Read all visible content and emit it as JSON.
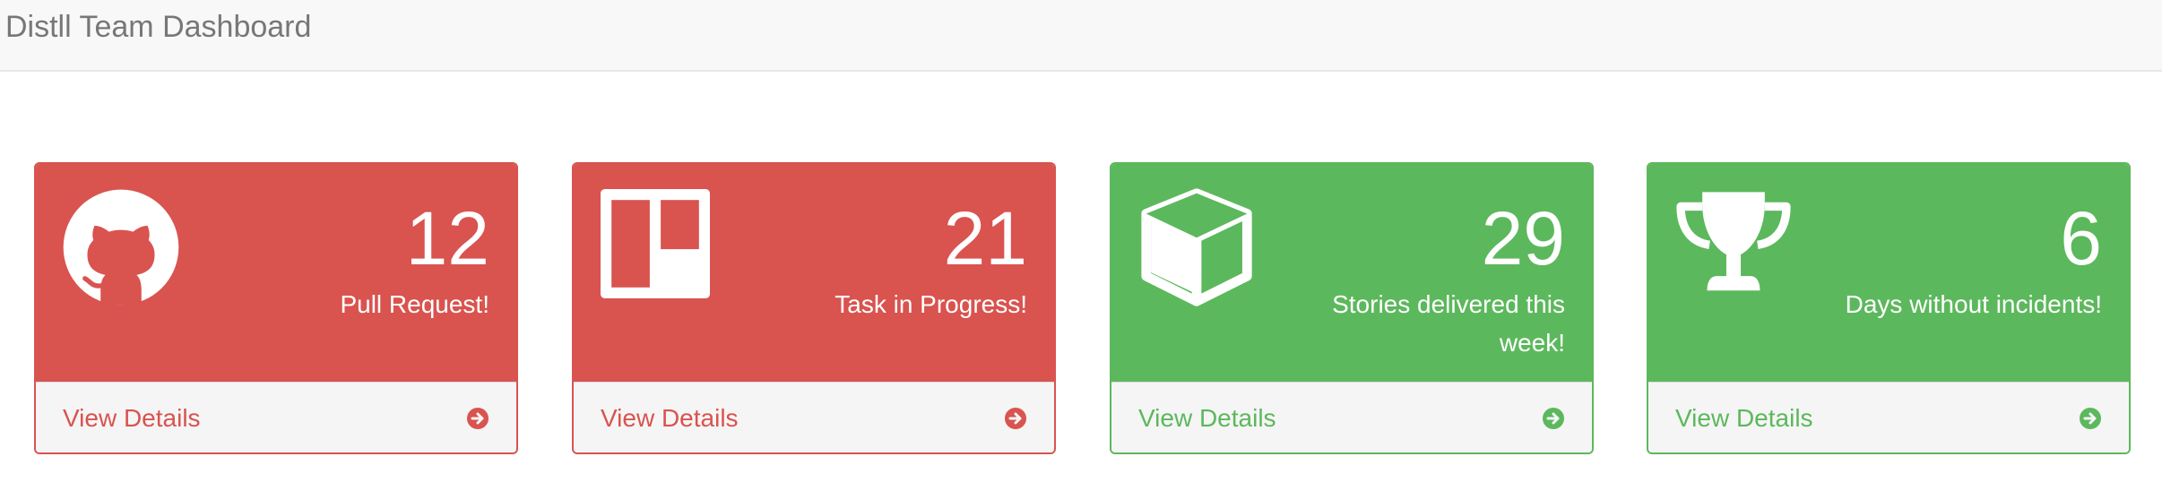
{
  "header": {
    "title": "Distll Team Dashboard"
  },
  "colors": {
    "danger": "#d9534f",
    "success": "#5cb85c"
  },
  "panels": [
    {
      "icon": "github-icon",
      "count": "12",
      "label": "Pull Request!",
      "footer": "View Details",
      "status": "danger"
    },
    {
      "icon": "trello-icon",
      "count": "21",
      "label": "Task in Progress!",
      "footer": "View Details",
      "status": "danger"
    },
    {
      "icon": "cube-icon",
      "count": "29",
      "label": "Stories delivered this week!",
      "footer": "View Details",
      "status": "success"
    },
    {
      "icon": "trophy-icon",
      "count": "6",
      "label": "Days without incidents!",
      "footer": "View Details",
      "status": "success"
    }
  ]
}
